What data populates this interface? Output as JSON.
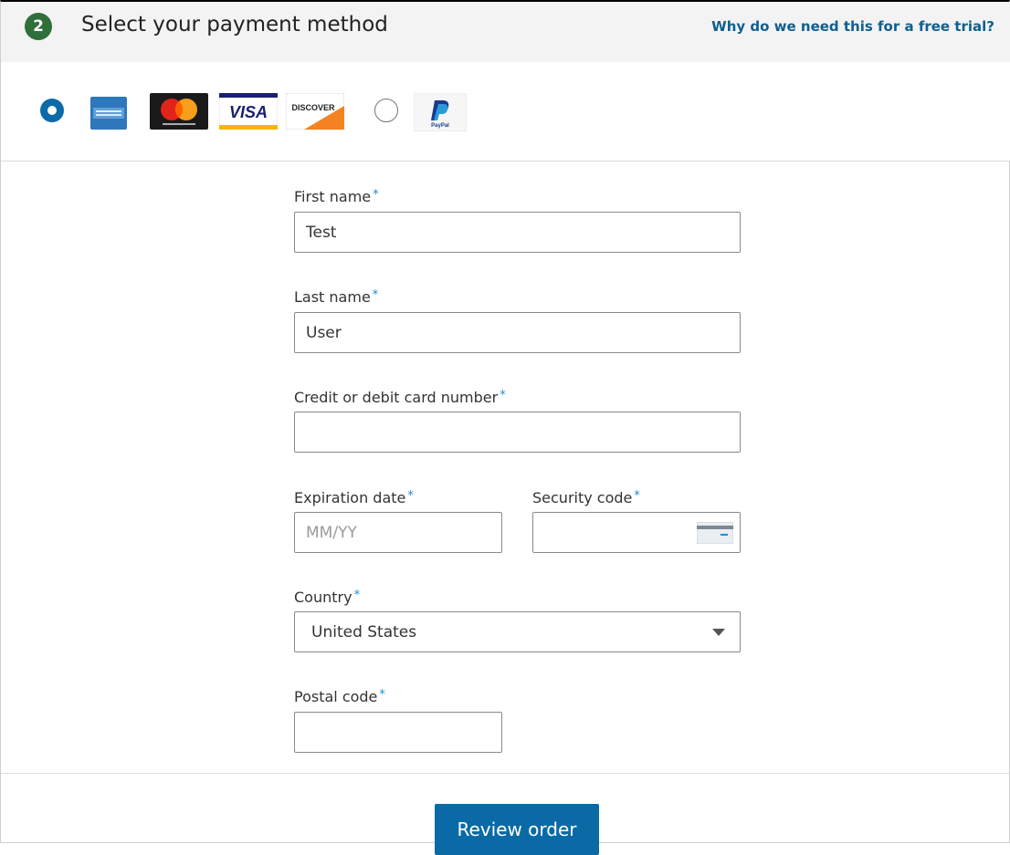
{
  "header": {
    "step_number": "2",
    "title": "Select your payment method",
    "help_link": "Why do we need this for a free trial?"
  },
  "payment_methods": {
    "selected": "card",
    "cards": [
      "american-express",
      "mastercard",
      "visa",
      "discover"
    ],
    "alternate": "paypal",
    "visa_text": "VISA",
    "discover_text": "DISCOVER",
    "paypal_text": "PayPal"
  },
  "form": {
    "first_name": {
      "label": "First name",
      "required": "*",
      "value": "Test"
    },
    "last_name": {
      "label": "Last name",
      "required": "*",
      "value": "User"
    },
    "card_number": {
      "label": "Credit or debit card number",
      "required": "*",
      "value": ""
    },
    "expiration": {
      "label": "Expiration date",
      "required": "*",
      "placeholder": "MM/YY",
      "value": ""
    },
    "security_code": {
      "label": "Security code",
      "required": "*",
      "value": ""
    },
    "country": {
      "label": "Country",
      "required": "*",
      "value": "United States"
    },
    "postal_code": {
      "label": "Postal code",
      "required": "*",
      "value": ""
    }
  },
  "actions": {
    "review_label": "Review order"
  },
  "colors": {
    "step_badge": "#2f6f3a",
    "link": "#0f5f8f",
    "primary": "#0a6aa5",
    "required_marker": "#1a8fd0"
  }
}
